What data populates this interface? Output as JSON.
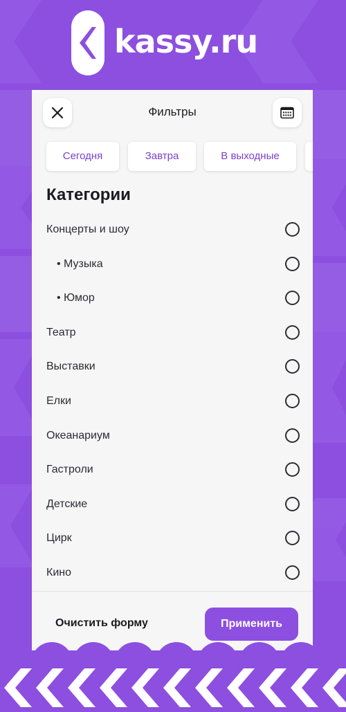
{
  "brand": {
    "name": "kassy.ru",
    "colors": {
      "primary": "#8c4fe0",
      "primary_dark": "#7c3fcf",
      "panel_bg": "#f6f6f7",
      "text": "#1b1b1f"
    }
  },
  "panel": {
    "title": "Фильтры",
    "close_icon": "close-icon",
    "calendar_icon": "calendar-icon"
  },
  "date_chips": [
    {
      "label": "Сегодня"
    },
    {
      "label": "Завтра"
    },
    {
      "label": "В выходные"
    }
  ],
  "categories": {
    "title": "Категории",
    "items": [
      {
        "label": "Концерты и шоу",
        "sub": false,
        "selected": false
      },
      {
        "label": "• Музыка",
        "sub": true,
        "selected": false
      },
      {
        "label": "• Юмор",
        "sub": true,
        "selected": false
      },
      {
        "label": "Театр",
        "sub": false,
        "selected": false
      },
      {
        "label": "Выставки",
        "sub": false,
        "selected": false
      },
      {
        "label": "Елки",
        "sub": false,
        "selected": false
      },
      {
        "label": "Океанариум",
        "sub": false,
        "selected": false
      },
      {
        "label": "Гастроли",
        "sub": false,
        "selected": false
      },
      {
        "label": "Детские",
        "sub": false,
        "selected": false
      },
      {
        "label": "Цирк",
        "sub": false,
        "selected": false
      },
      {
        "label": "Кино",
        "sub": false,
        "selected": false
      }
    ]
  },
  "footer": {
    "clear_label": "Очистить форму",
    "apply_label": "Применить"
  }
}
